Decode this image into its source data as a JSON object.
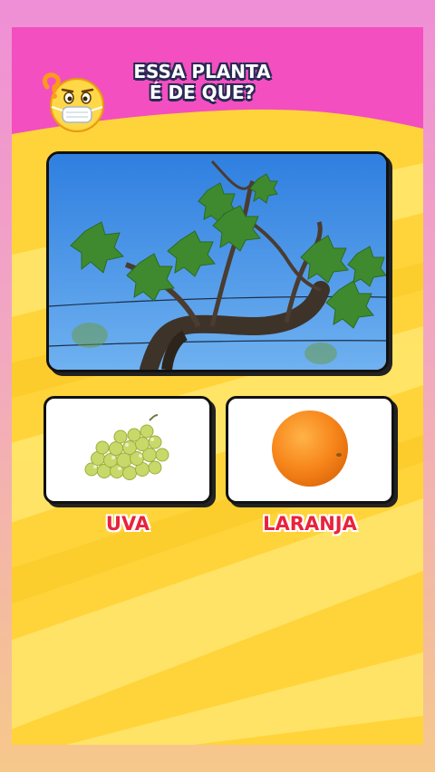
{
  "question": {
    "line1": "ESSA PLANTA",
    "line2": "É DE QUE?"
  },
  "emoji": "thinking-face-with-mask",
  "photo": "grapevine-branch",
  "options": [
    {
      "label": "UVA",
      "image": "green-grapes"
    },
    {
      "label": "LARANJA",
      "image": "orange-fruit"
    }
  ],
  "colors": {
    "header_pink": "#f34fc0",
    "background_yellow": "#ffd43a",
    "label_red": "#e8233e",
    "sky_blue": "#3f8fe6"
  }
}
